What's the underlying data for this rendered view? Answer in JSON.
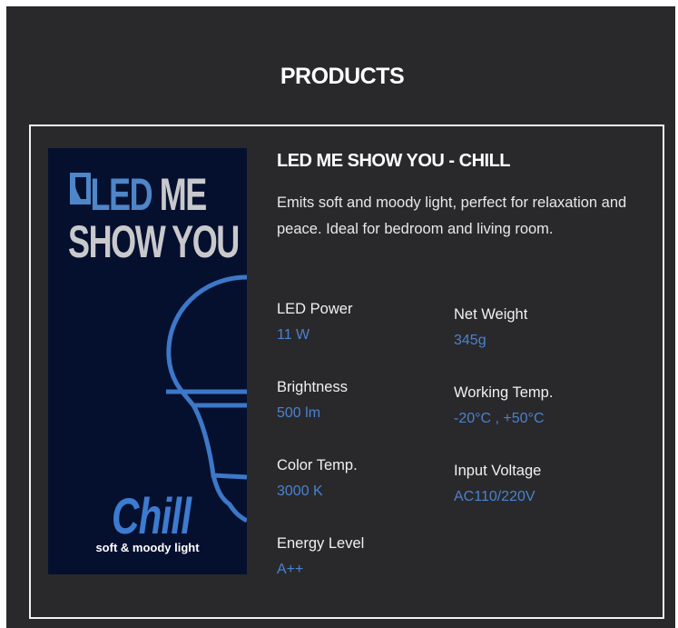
{
  "section": {
    "title": "PRODUCTS"
  },
  "product": {
    "image": {
      "brand_line1_part1": "LED",
      "brand_line1_part2": "ME",
      "brand_line2": "SHOW YOU",
      "script_text": "Chill",
      "tagline": "soft & moody light",
      "icon": "light-bulb-icon"
    },
    "name": "LED ME SHOW YOU - CHILL",
    "description": "Emits soft and moody light, perfect for relaxation and peace. Ideal for bedroom and living room.",
    "specs_left": [
      {
        "label": "LED Power",
        "value": "11 W"
      },
      {
        "label": "Brightness",
        "value": "500 lm"
      },
      {
        "label": "Color Temp.",
        "value": "3000 K"
      },
      {
        "label": "Energy Level",
        "value": "A++"
      }
    ],
    "specs_right": [
      {
        "label": "Net Weight",
        "value": "345g"
      },
      {
        "label": "Working Temp.",
        "value": "-20°C , +50°C"
      },
      {
        "label": "Input Voltage",
        "value": "AC110/220V"
      }
    ]
  },
  "colors": {
    "background": "#29292b",
    "accent": "#4a82cf",
    "image_bg": "#05102f"
  }
}
